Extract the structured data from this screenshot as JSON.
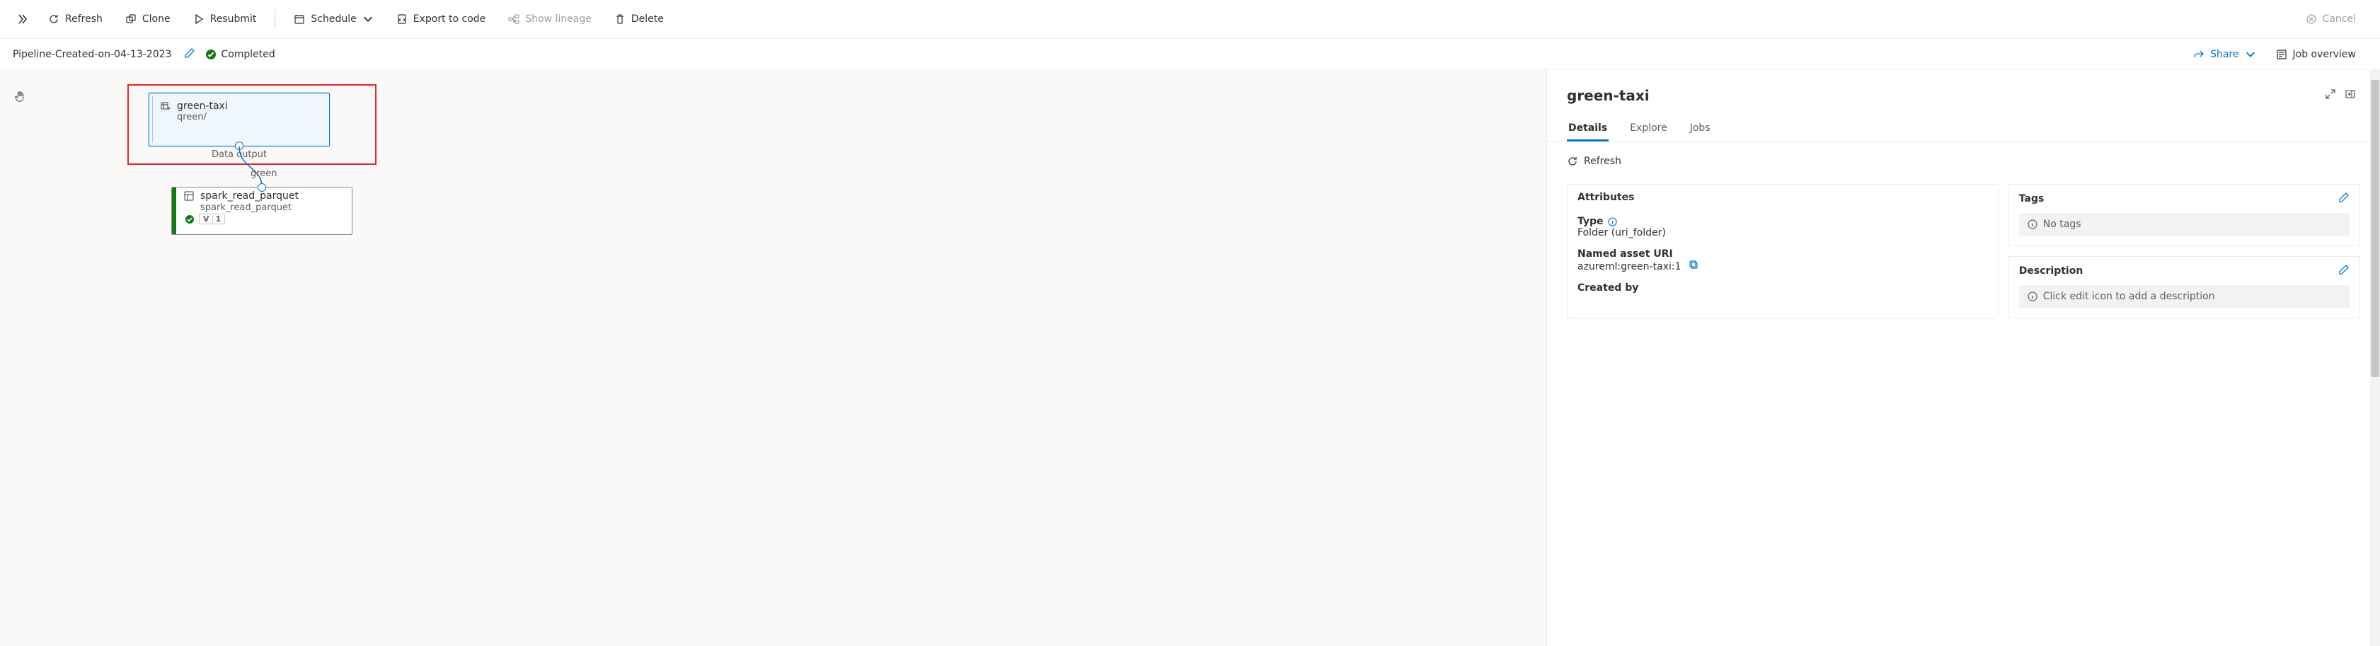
{
  "toolbar": {
    "refresh_label": "Refresh",
    "clone_label": "Clone",
    "resubmit_label": "Resubmit",
    "schedule_label": "Schedule",
    "export_label": "Export to code",
    "lineage_label": "Show lineage",
    "delete_label": "Delete",
    "cancel_label": "Cancel"
  },
  "header": {
    "pipeline_name": "Pipeline-Created-on-04-13-2023",
    "status": "Completed",
    "share_label": "Share",
    "job_overview_label": "Job overview"
  },
  "canvas": {
    "node1": {
      "title": "green-taxi",
      "subtitle": "qreen/",
      "output_label": "Data output"
    },
    "edge_label": "green",
    "node2": {
      "title": "spark_read_parquet",
      "subtitle": "spark_read_parquet",
      "version_letter": "V",
      "version_num": "1"
    }
  },
  "panel": {
    "title": "green-taxi",
    "tabs": {
      "details": "Details",
      "explore": "Explore",
      "jobs": "Jobs"
    },
    "refresh_label": "Refresh",
    "attributes": {
      "heading": "Attributes",
      "type_label": "Type",
      "type_value": "Folder (uri_folder)",
      "named_uri_label": "Named asset URI",
      "named_uri_value": "azureml:green-taxi:1",
      "created_by_label": "Created by"
    },
    "tags": {
      "heading": "Tags",
      "empty": "No tags"
    },
    "description": {
      "heading": "Description",
      "empty": "Click edit icon to add a description"
    }
  }
}
